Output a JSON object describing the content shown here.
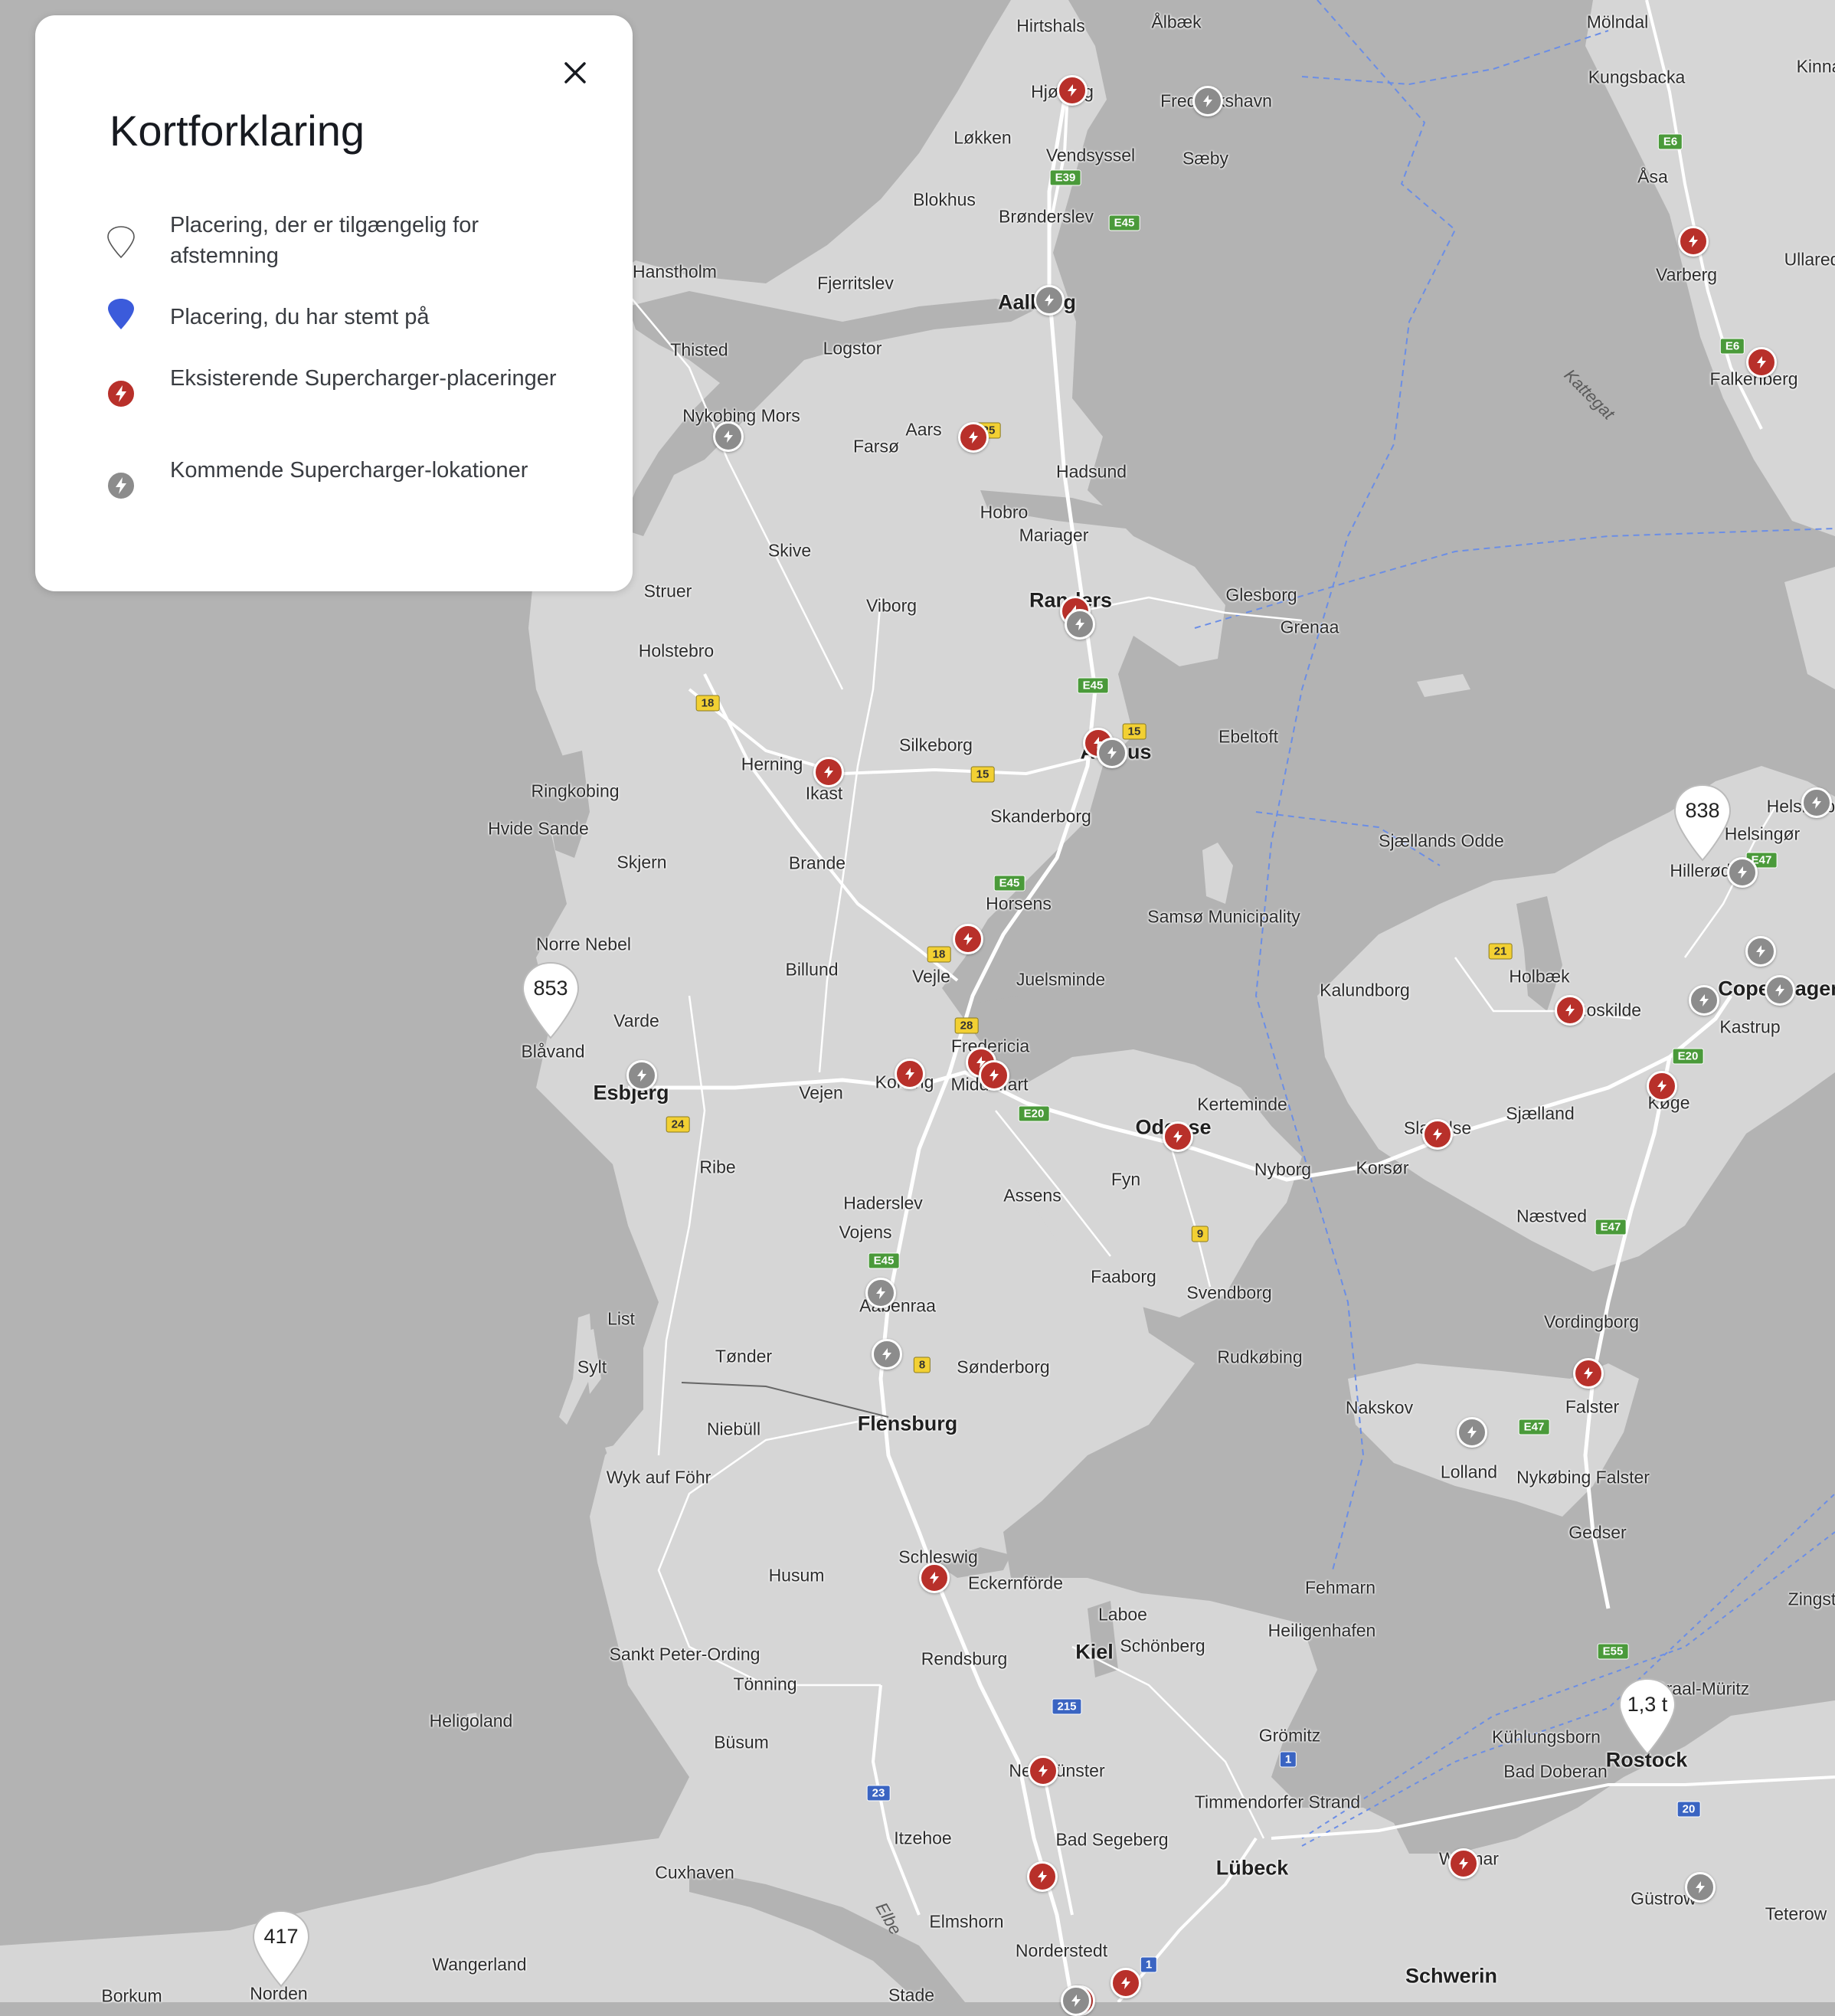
{
  "legend": {
    "title": "Kortforklaring",
    "close_icon": "close-icon",
    "items": [
      {
        "icon": "outline-pin-icon",
        "text": "Placering, der er tilgængelig for afstemning"
      },
      {
        "icon": "blue-pin-icon",
        "text": "Placering, du har stemt på"
      },
      {
        "icon": "red-supercharger-icon",
        "text": "Eksisterende Supercharger-placeringer"
      },
      {
        "icon": "grey-supercharger-icon",
        "text": "Kommende Supercharger-lokationer"
      }
    ]
  },
  "colors": {
    "existing": "#b8302a",
    "upcoming": "#8c8c8c",
    "voted": "#3b5bdb",
    "water": "#b3b3b3",
    "land": "#d4d4d4"
  },
  "vote_pins": [
    {
      "label": "853",
      "place": "Blåvand"
    },
    {
      "label": "838",
      "place": "Hillerød"
    },
    {
      "label": "1,3 t",
      "place": "Rostock"
    },
    {
      "label": "417",
      "place": "Norden"
    }
  ],
  "place_labels": [
    "Hirtshals",
    "Ålbæk",
    "Hjørring",
    "Frederikshavn",
    "Løkken",
    "Vendsyssel",
    "Sæby",
    "Blokhus",
    "Brønderslev",
    "Hanstholm",
    "Fjerritslev",
    "Aalborg",
    "Thisted",
    "Logstor",
    "Nykobing Mors",
    "Farsø",
    "Aars",
    "Hadsund",
    "Hobro",
    "Mariager",
    "Skive",
    "Struer",
    "Viborg",
    "Randers",
    "Glesborg",
    "Grenaa",
    "Holstebro",
    "Herning",
    "Silkeborg",
    "Aarhus",
    "Ebeltoft",
    "Ikast",
    "Ringkobing",
    "Hvide Sande",
    "Skjern",
    "Brande",
    "Skanderborg",
    "Horsens",
    "Samsø Municipality",
    "Norre Nebel",
    "Billund",
    "Vejle",
    "Juelsminde",
    "Varde",
    "Blåvand",
    "Esbjerg",
    "Fredericia",
    "Kolding",
    "Middelfart",
    "Vejen",
    "Odense",
    "Kerteminde",
    "Ribe",
    "Assens",
    "Fyn",
    "Nyborg",
    "Korsør",
    "Haderslev",
    "Vojens",
    "Faaborg",
    "Svendborg",
    "Aabenraa",
    "Tønder",
    "Sønderborg",
    "Rudkøbing",
    "Sylt",
    "List",
    "Niebüll",
    "Flensburg",
    "Wyk auf Föhr",
    "Nakskov",
    "Lolland",
    "Nykøbing Falster",
    "Gedser",
    "Schleswig",
    "Eckernförde",
    "Husum",
    "Sankt Peter-Ording",
    "Tönning",
    "Rendsburg",
    "Kiel",
    "Laboe",
    "Schönberg",
    "Fehmarn",
    "Heiligenhafen",
    "Heligoland",
    "Büsum",
    "Neumünster",
    "Grömitz",
    "Timmendorfer Strand",
    "Itzehoe",
    "Bad Segeberg",
    "Lübeck",
    "Cuxhaven",
    "Elmshorn",
    "Norderstedt",
    "Wangerland",
    "Norden",
    "Borkum",
    "Stade",
    "Schwerin",
    "Wismar",
    "Güstrow",
    "Teterow",
    "Rostock",
    "Bad Doberan",
    "Kühlungsborn",
    "Graal-Müritz",
    "Zingst",
    "Falster",
    "Vordingborg",
    "Næstved",
    "Sjælland",
    "Køge",
    "Roskilde",
    "Kastrup",
    "Copenhagen",
    "Holbæk",
    "Kalundborg",
    "Slagelse",
    "Sjællands Odde",
    "Hillerød",
    "Helsingør",
    "Helsingborg",
    "Mölndal",
    "Kungsbacka",
    "Åsa",
    "Varberg",
    "Falkenberg",
    "Ullared",
    "Kattegat",
    "Kinna",
    "Elbe"
  ]
}
